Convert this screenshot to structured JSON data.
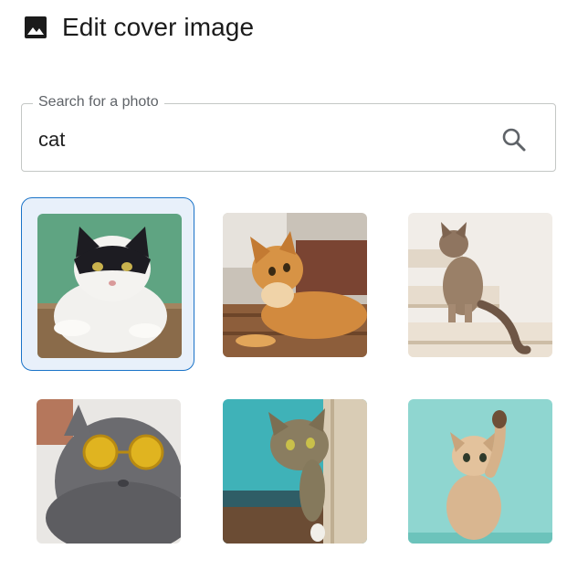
{
  "header": {
    "title": "Edit cover image",
    "icon": "image-icon"
  },
  "search": {
    "label": "Search for a photo",
    "value": "cat",
    "button_icon": "search-icon"
  },
  "results": {
    "selected_index": 0,
    "photos": [
      {
        "subject": "black-and-white cat on green background"
      },
      {
        "subject": "orange tabby cat lying on floor"
      },
      {
        "subject": "tabby cat sitting on stairs"
      },
      {
        "subject": "grey cat wearing yellow sunglasses"
      },
      {
        "subject": "tabby cat peeking around wall"
      },
      {
        "subject": "ginger kitten reaching up on teal background"
      }
    ]
  },
  "colors": {
    "accent": "#1a73c8",
    "selected_bg": "#e8f0fa",
    "border": "#c4c7c5"
  }
}
